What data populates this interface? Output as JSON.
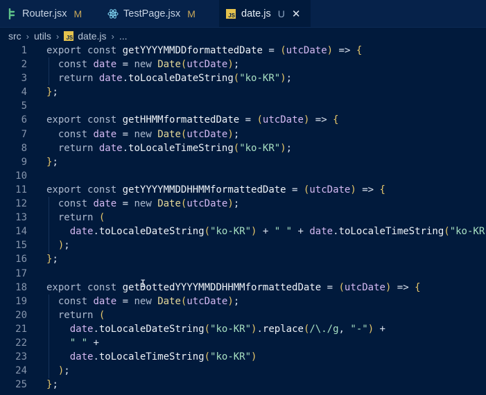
{
  "tabs": [
    {
      "label": "Router.jsx",
      "status": "M",
      "icon": "git-branch-icon",
      "active": false
    },
    {
      "label": "TestPage.jsx",
      "status": "M",
      "icon": "react-icon",
      "active": false
    },
    {
      "label": "date.js",
      "status": "U",
      "icon": "javascript-file-icon",
      "active": true
    }
  ],
  "breadcrumb": {
    "folder1": "src",
    "folder2": "utils",
    "file": "date.js",
    "more": "...",
    "file_icon_text": "JS"
  },
  "colors": {
    "background": "#011a3c",
    "tabbar": "#06224a",
    "keyword": "#aebbd0",
    "variable": "#d4b9f2",
    "class": "#e6d99a",
    "string": "#a7e0c2",
    "bracket": "#e8c86a",
    "modified": "#c9a85a"
  },
  "code_lines": [
    "export const getYYYYMMDDformattedDate = (utcDate) => {",
    "  const date = new Date(utcDate);",
    "  return date.toLocaleDateString(\"ko-KR\");",
    "};",
    "",
    "export const getHHMMformattedDate = (utcDate) => {",
    "  const date = new Date(utcDate);",
    "  return date.toLocaleTimeString(\"ko-KR\");",
    "};",
    "",
    "export const getYYYYMMDDHHMMformattedDate = (utcDate) => {",
    "  const date = new Date(utcDate);",
    "  return (",
    "    date.toLocaleDateString(\"ko-KR\") + \" \" + date.toLocaleTimeString(\"ko-KR\")",
    "  );",
    "};",
    "",
    "export const getDottedYYYYMMDDHHMMformattedDate = (utcDate) => {",
    "  const date = new Date(utcDate);",
    "  return (",
    "    date.toLocaleDateString(\"ko-KR\").replace(/\\./g, \"-\") +",
    "    \" \" +",
    "    date.toLocaleTimeString(\"ko-KR\")",
    "  );",
    "};"
  ]
}
